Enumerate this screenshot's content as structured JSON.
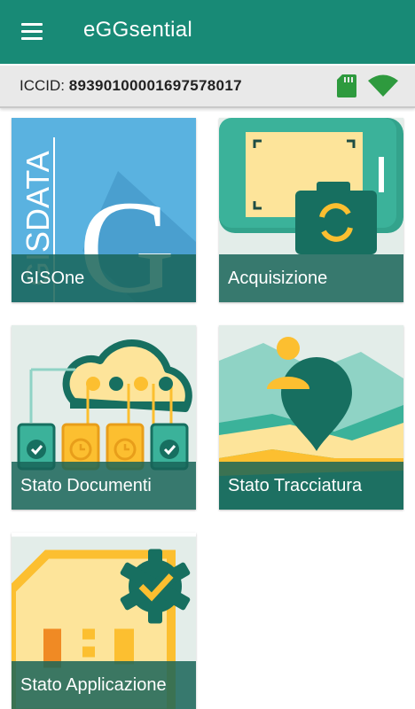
{
  "app": {
    "title": "eGGsential"
  },
  "infobar": {
    "iccid_label": "ICCID:",
    "iccid_value": "89390100001697578017"
  },
  "icons": {
    "menu": "hamburger-menu-icon",
    "sd": "sd-card-icon",
    "wifi": "wifi-signal-icon"
  },
  "colors": {
    "primary": "#188a76",
    "accent": "#fcbf30",
    "tile_blue": "#5ab2e0"
  },
  "tiles": [
    {
      "label": "GISOne",
      "art_text": "GISDATA",
      "art_letter": "G"
    },
    {
      "label": "Acquisizione"
    },
    {
      "label": "Stato Documenti"
    },
    {
      "label": "Stato Tracciatura"
    },
    {
      "label": "Stato Applicazione"
    }
  ]
}
